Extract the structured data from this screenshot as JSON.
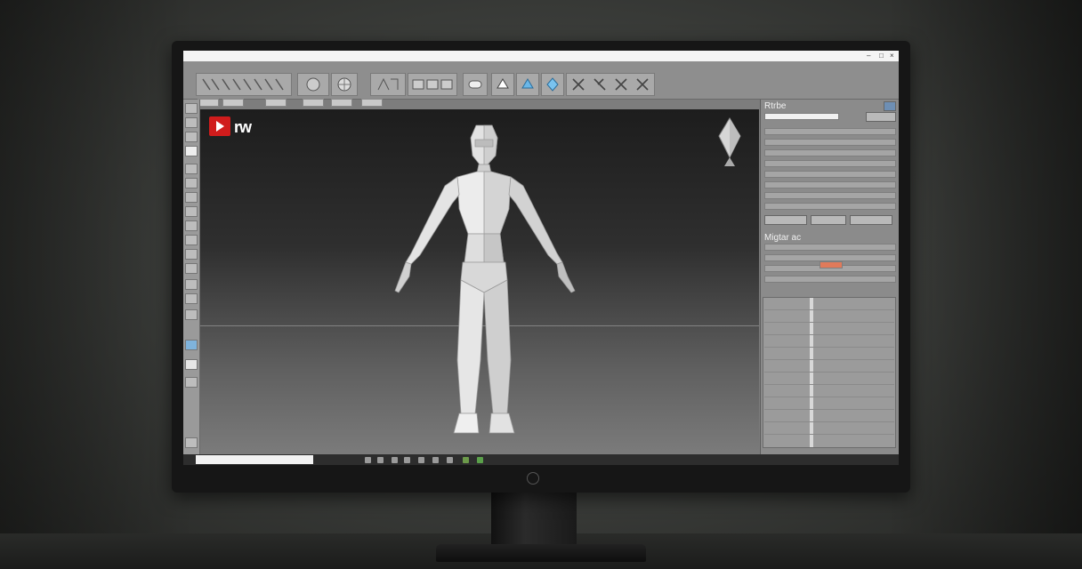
{
  "window": {
    "title": "",
    "menu_items": [
      "",
      "",
      "",
      "",
      ""
    ]
  },
  "viewport": {
    "logo_text": "rw"
  },
  "panels": {
    "top_title": "Rtrbe",
    "bottom_title": "Migtar ac"
  },
  "taskbar": {
    "clock": ""
  },
  "colors": {
    "logo_red": "#d01c1c",
    "viewport_bg_top": "#1d1d1d",
    "panel_gray": "#8b8b8b"
  },
  "icons": [
    "logo-play-icon",
    "view-cube-icon",
    "human-model"
  ]
}
